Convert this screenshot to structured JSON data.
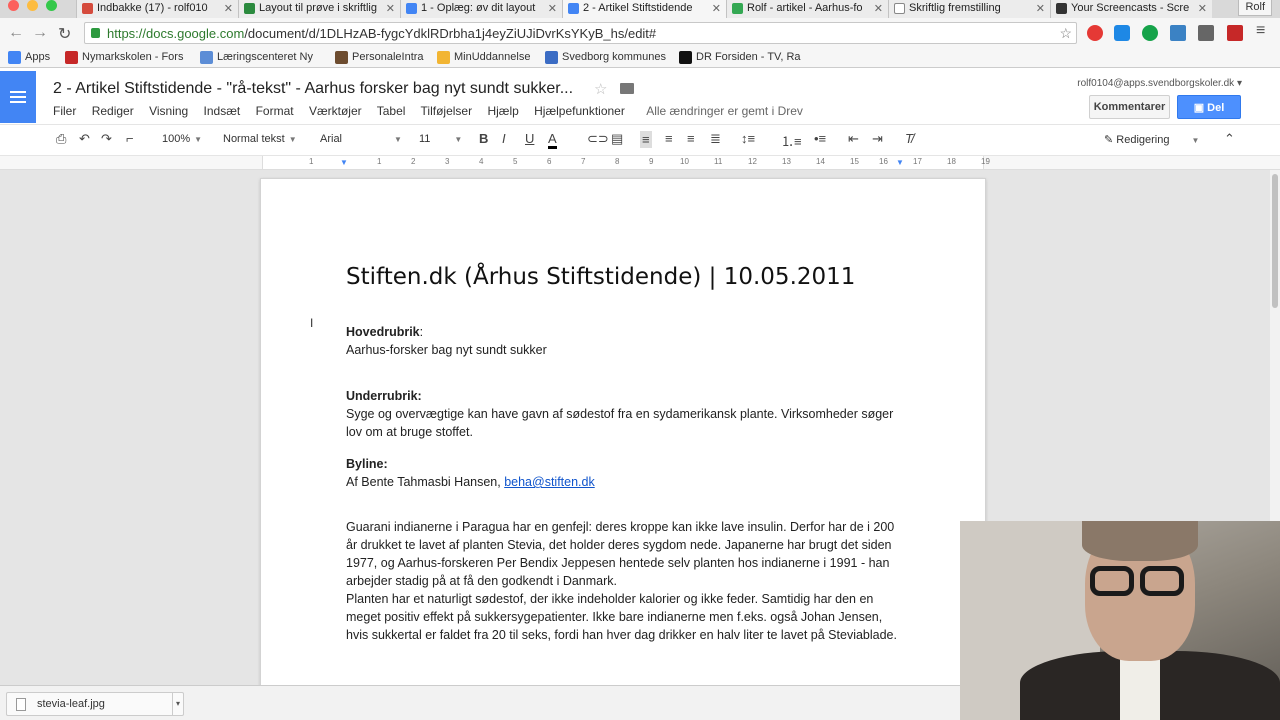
{
  "browser": {
    "tabs": [
      {
        "label": "Indbakke (17) - rolf010",
        "color": "#d54b3d"
      },
      {
        "label": "Layout til prøve i skriftlig",
        "color": "#2b8a3e"
      },
      {
        "label": "1 - Oplæg: øv dit layout",
        "color": "#4285f4"
      },
      {
        "label": "2 - Artikel Stiftstidende",
        "color": "#4285f4"
      },
      {
        "label": "Rolf - artikel - Aarhus-fo",
        "color": "#34a853"
      },
      {
        "label": "Skriftlig fremstilling",
        "color": "#888888"
      },
      {
        "label": "Your Screencasts - Scre",
        "color": "#333333"
      }
    ],
    "user_chip": "Rolf",
    "url_host": "https://docs.google.com",
    "url_path": "/document/d/1DLHzAB-fygcYdklRDrbha1j4eyZiUJiDvrKsYKyB_hs/edit#",
    "bookmarks": [
      {
        "label": "Apps",
        "color": "#4285f4"
      },
      {
        "label": "Nymarkskolen - Fors",
        "color": "#c62828"
      },
      {
        "label": "Læringscenteret Ny",
        "color": "#5c8dd6"
      },
      {
        "label": "PersonaleIntra",
        "color": "#6d4c2f"
      },
      {
        "label": "MinUddannelse",
        "color": "#f2b533"
      },
      {
        "label": "Svedborg kommunes",
        "color": "#3b6cc4"
      },
      {
        "label": "DR Forsiden - TV, Ra",
        "color": "#111111"
      }
    ]
  },
  "docs": {
    "title": "2 - Artikel Stiftstidende - \"rå-tekst\" - Aarhus forsker bag nyt sundt sukker...",
    "account": "rolf0104@apps.svendborgskoler.dk",
    "menu": [
      "Filer",
      "Rediger",
      "Visning",
      "Indsæt",
      "Format",
      "Værktøjer",
      "Tabel",
      "Tilføjelser",
      "Hjælp",
      "Hjælpefunktioner"
    ],
    "saved_status": "Alle ændringer er gemt i Drev",
    "comment_button": "Kommentarer",
    "share_button": "Del",
    "toolbar": {
      "zoom": "100%",
      "style": "Normal tekst",
      "font": "Arial",
      "size": "11",
      "mode": "Redigering"
    },
    "ruler": [
      "1",
      "1",
      "2",
      "3",
      "4",
      "5",
      "6",
      "7",
      "8",
      "9",
      "10",
      "11",
      "12",
      "13",
      "14",
      "15",
      "16",
      "17",
      "18",
      "19"
    ]
  },
  "document": {
    "heading": "Stiften.dk (Århus Stiftstidende) | 10.05.2011",
    "hoved_label": "Hovedrubrik",
    "hoved_colon": ":",
    "hoved_text": "Aarhus-forsker bag nyt sundt sukker",
    "under_label": "Underrubrik:",
    "under_text": "Syge og overvægtige kan have gavn af sødestof fra en sydamerikansk plante. Virksomheder søger lov om at bruge stoffet.",
    "byline_label": "Byline:",
    "byline_text": "Af Bente Tahmasbi Hansen, ",
    "byline_email": "beha@stiften.dk",
    "body_p1": "Guarani indianerne i Paragua har en genfejl: deres kroppe kan ikke lave insulin. Derfor har de i 200 år drukket te lavet af planten Stevia, det holder deres sygdom nede. Japanerne har brugt det siden 1977, og Aarhus-forskeren Per Bendix Jeppesen hentede selv planten hos indianerne i 1991 - han arbejder stadig på at få den godkendt i Danmark.",
    "body_p2": "Planten har et naturligt sødestof, der ikke indeholder kalorier og ikke feder. Samtidig har den en meget positiv effekt på sukkersygepatienter. Ikke bare indianerne men f.eks. også Johan Jensen, hvis sukkertal er faldet fra 20 til seks, fordi han hver dag drikker en halv liter te lavet på Steviablade."
  },
  "download": {
    "filename": "stevia-leaf.jpg"
  }
}
